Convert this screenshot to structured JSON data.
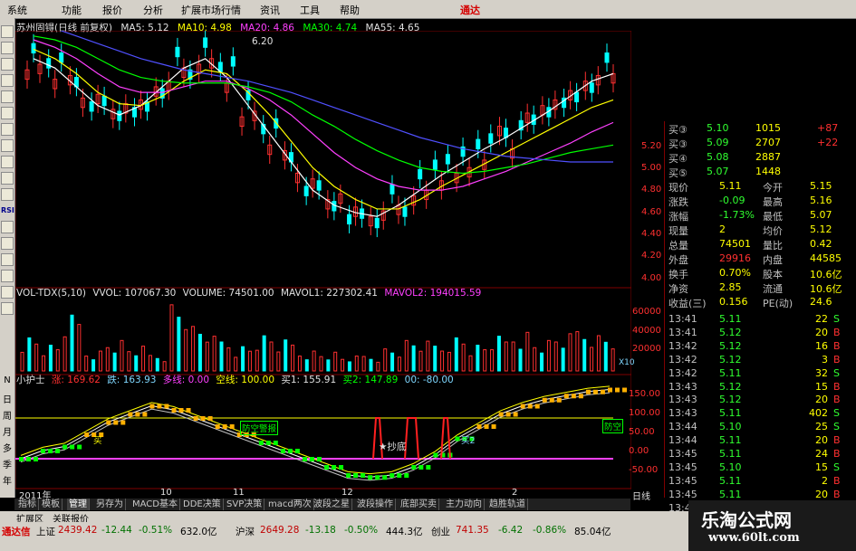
{
  "menu": {
    "items": [
      "系统",
      "功能",
      "报价",
      "分析",
      "扩展市场行情",
      "资讯",
      "工具",
      "帮助"
    ],
    "brand": "通达"
  },
  "toolbar": {
    "icons": [
      "chart-icon",
      "chart-icon",
      "chart-icon",
      "chart-icon",
      "chart-icon",
      "chart-icon",
      "chart-icon",
      "chart-icon",
      "chart-icon",
      "chart-icon",
      "chart-icon",
      "chart-icon",
      "chart-icon",
      "chart-icon",
      "chart-icon",
      "chart-icon",
      "chart-icon"
    ],
    "rsi_label": "RSI",
    "period_labels": [
      "N",
      "日",
      "周",
      "月",
      "多",
      "季",
      "年"
    ]
  },
  "price_header": {
    "title": "苏州固锝(日线 前复权)",
    "ma5": "MA5: 5.12",
    "ma10": "MA10: 4.98",
    "ma20": "MA20: 4.86",
    "ma30": "MA30: 4.74",
    "ma55": "MA55: 4.65",
    "high_label": "6.20"
  },
  "volume_header": {
    "title": "VOL-TDX(5,10)",
    "vvol": "VVOL: 107067.30",
    "volume": "VOLUME: 74501.00",
    "mavol1": "MAVOL1: 227302.41",
    "mavol2": "MAVOL2: 194015.59"
  },
  "indicator_header": {
    "name": "小护士",
    "up": "涨: 169.62",
    "down": "跌: 163.93",
    "long": "多线: 0.00",
    "short": "空线: 100.00",
    "buy1": "买1: 155.91",
    "buy2": "买2: 147.89",
    "extra": "00: -80.00"
  },
  "annotations": {
    "bottom": "★抄底",
    "sell_warn": "防空警报",
    "prevent": "防空",
    "buy": "买",
    "buy2": "买2",
    "multiplier": "X10"
  },
  "axes": {
    "price_ticks": [
      "5.20",
      "5.00",
      "4.80",
      "4.60",
      "4.40",
      "4.20",
      "4.00"
    ],
    "volume_ticks": [
      "60000",
      "40000",
      "20000"
    ],
    "indicator_ticks": [
      "150.00",
      "100.00",
      "50.00",
      "0.00",
      "-50.00"
    ],
    "date_labels": [
      "2011年",
      "10",
      "11",
      "12",
      "2"
    ]
  },
  "chart_data": [
    {
      "type": "line",
      "title": "苏州固锝(日线 前复权)",
      "series": [
        {
          "name": "MA5",
          "values": [
            5.2,
            5.15,
            5.05,
            4.95,
            4.9,
            4.95,
            5.05,
            5.15,
            5.2,
            5.1,
            4.95,
            4.8,
            4.65,
            4.5,
            4.42,
            4.38,
            4.36,
            4.42,
            4.5,
            4.58,
            4.65,
            4.72,
            4.78,
            4.85,
            4.92,
            5.0,
            5.08,
            5.12
          ]
        },
        {
          "name": "MA10",
          "values": [
            5.25,
            5.2,
            5.12,
            5.02,
            4.96,
            4.95,
            5.0,
            5.08,
            5.14,
            5.12,
            5.02,
            4.9,
            4.76,
            4.62,
            4.52,
            4.45,
            4.4,
            4.4,
            4.45,
            4.52,
            4.58,
            4.64,
            4.7,
            4.76,
            4.82,
            4.88,
            4.94,
            4.98
          ]
        },
        {
          "name": "MA20",
          "values": [
            5.3,
            5.26,
            5.2,
            5.12,
            5.05,
            5.02,
            5.02,
            5.05,
            5.08,
            5.08,
            5.04,
            4.98,
            4.9,
            4.8,
            4.7,
            4.62,
            4.56,
            4.52,
            4.5,
            4.5,
            4.52,
            4.56,
            4.6,
            4.65,
            4.7,
            4.75,
            4.81,
            4.86
          ]
        },
        {
          "name": "MA30",
          "values": [
            5.32,
            5.3,
            5.26,
            5.2,
            5.14,
            5.1,
            5.08,
            5.07,
            5.07,
            5.07,
            5.05,
            5.02,
            4.97,
            4.9,
            4.84,
            4.77,
            4.71,
            4.66,
            4.62,
            4.6,
            4.59,
            4.6,
            4.62,
            4.64,
            4.67,
            4.7,
            4.72,
            4.74
          ]
        },
        {
          "name": "MA55",
          "values": [
            5.4,
            5.36,
            5.32,
            5.28,
            5.24,
            5.2,
            5.17,
            5.14,
            5.12,
            5.1,
            5.08,
            5.05,
            5.02,
            4.98,
            4.94,
            4.9,
            4.86,
            4.82,
            4.78,
            4.75,
            4.72,
            4.7,
            4.68,
            4.67,
            4.66,
            4.65,
            4.65,
            4.65
          ]
        }
      ],
      "ylim": [
        4.0,
        5.3
      ]
    },
    {
      "type": "bar",
      "title": "VOL-TDX(5,10)",
      "values": [
        30000,
        22000,
        45000,
        18000,
        26000,
        20000,
        15000,
        60000,
        38000,
        28000,
        22000,
        30000,
        25000,
        18000,
        16000,
        12000,
        14000,
        20000,
        26000,
        24000,
        30000,
        22000,
        28000,
        35000,
        26000,
        30000,
        38000,
        32000
      ],
      "ylim": [
        0,
        70000
      ]
    },
    {
      "type": "line",
      "title": "小护士",
      "series": [
        {
          "name": "涨",
          "values": [
            0,
            20,
            30,
            60,
            90,
            110,
            130,
            120,
            100,
            80,
            60,
            40,
            20,
            0,
            -20,
            -40,
            -45,
            -40,
            -20,
            10,
            50,
            80,
            110,
            130,
            145,
            155,
            165,
            170
          ]
        }
      ],
      "ylim": [
        -60,
        180
      ]
    }
  ],
  "quote": {
    "top_rows": [
      {
        "label": "买③",
        "price": "5.10",
        "vol": "1015",
        "chg": "+87"
      },
      {
        "label": "买③",
        "price": "5.09",
        "vol": "2707",
        "chg": "+22"
      },
      {
        "label": "买④",
        "price": "5.08",
        "vol": "2887",
        "chg": ""
      },
      {
        "label": "买⑤",
        "price": "5.07",
        "vol": "1448",
        "chg": ""
      }
    ],
    "stats": [
      {
        "l1": "现价",
        "v1": "5.11",
        "l2": "今开",
        "v2": "5.15"
      },
      {
        "l1": "涨跌",
        "v1": "-0.09",
        "l2": "最高",
        "v2": "5.16"
      },
      {
        "l1": "涨幅",
        "v1": "-1.73%",
        "l2": "最低",
        "v2": "5.07"
      },
      {
        "l1": "现量",
        "v1": "2",
        "l2": "均价",
        "v2": "5.12"
      },
      {
        "l1": "总量",
        "v1": "74501",
        "l2": "量比",
        "v2": "0.42"
      },
      {
        "l1": "外盘",
        "v1": "29916",
        "l2": "内盘",
        "v2": "44585"
      },
      {
        "l1": "换手",
        "v1": "0.70%",
        "l2": "股本",
        "v2": "10.6亿"
      },
      {
        "l1": "净资",
        "v1": "2.85",
        "l2": "流通",
        "v2": "10.6亿"
      },
      {
        "l1": "收益(三)",
        "v1": "0.156",
        "l2": "PE(动)",
        "v2": "24.6"
      }
    ],
    "trades": [
      {
        "t": "13:41",
        "p": "5.11",
        "v": "22",
        "d": "S"
      },
      {
        "t": "13:41",
        "p": "5.12",
        "v": "20",
        "d": "B"
      },
      {
        "t": "13:42",
        "p": "5.12",
        "v": "16",
        "d": "B"
      },
      {
        "t": "13:42",
        "p": "5.12",
        "v": "3",
        "d": "B"
      },
      {
        "t": "13:42",
        "p": "5.11",
        "v": "32",
        "d": "S"
      },
      {
        "t": "13:43",
        "p": "5.12",
        "v": "15",
        "d": "B"
      },
      {
        "t": "13:43",
        "p": "5.12",
        "v": "20",
        "d": "B"
      },
      {
        "t": "13:43",
        "p": "5.11",
        "v": "402",
        "d": "S"
      },
      {
        "t": "13:44",
        "p": "5.10",
        "v": "25",
        "d": "S"
      },
      {
        "t": "13:44",
        "p": "5.11",
        "v": "20",
        "d": "B"
      },
      {
        "t": "13:45",
        "p": "5.11",
        "v": "24",
        "d": "B"
      },
      {
        "t": "13:45",
        "p": "5.10",
        "v": "15",
        "d": "S"
      },
      {
        "t": "13:45",
        "p": "5.11",
        "v": "2",
        "d": "B"
      },
      {
        "t": "13:45",
        "p": "5.11",
        "v": "20",
        "d": "B"
      },
      {
        "t": "13:45",
        "p": "5.11",
        "v": "10",
        "d": "B"
      },
      {
        "t": "13:46",
        "p": "5.11",
        "v": "157",
        "d": "B"
      },
      {
        "t": "13:46",
        "p": "5.11",
        "v": "3",
        "d": "S"
      }
    ],
    "day_line_label": "日线"
  },
  "tabs": [
    "指标",
    "模板",
    "管理",
    "另存为",
    "MACD基本",
    "DDE决策",
    "SVP决策",
    "macd两次",
    "波段之星",
    "波段操作",
    "底部买卖",
    "主力动向",
    "趋胜轨道"
  ],
  "extra_bar": [
    "扩展区",
    "关联报价"
  ],
  "status": {
    "brand": "通达信",
    "sh": {
      "name": "上证",
      "index": "2439.42",
      "change": "-12.44",
      "pct": "-0.51%",
      "amount": "632.0亿"
    },
    "sz": {
      "name": "沪深",
      "index": "2649.28",
      "change": "-13.18",
      "pct": "-0.50%",
      "amount": "444.3亿"
    },
    "cy": {
      "name": "创业",
      "index": "741.35",
      "change": "-6.42",
      "pct": "-0.86%",
      "amount": "85.04亿"
    }
  },
  "watermark": {
    "line1": "乐淘公式网",
    "line2": "www.60lt.com"
  },
  "colors": {
    "up": "#ff3030",
    "down": "#00ffff",
    "ma5": "#ffffff",
    "ma10": "#ffff00",
    "ma20": "#ff40ff",
    "ma30": "#00ff00",
    "ma55": "#5050ff"
  }
}
